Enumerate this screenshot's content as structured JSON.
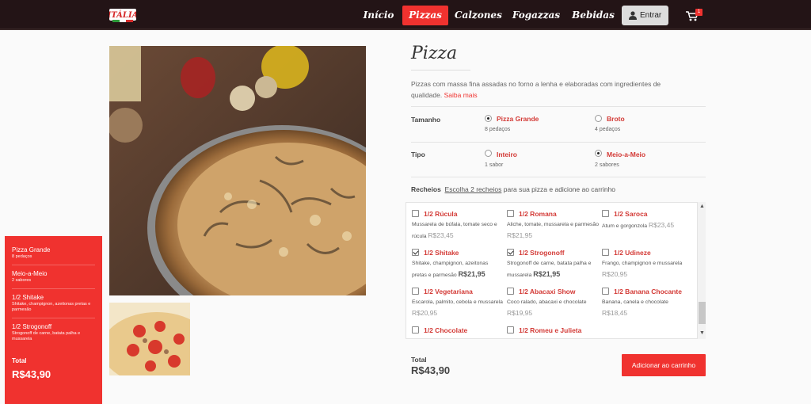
{
  "nav": {
    "logo": "ITÁLIA",
    "items": [
      "Início",
      "Pizzas",
      "Calzones",
      "Fogazzas",
      "Bebidas"
    ],
    "login": "Entrar",
    "cart_count": "1"
  },
  "sidebar": {
    "items": [
      {
        "name": "Pizza Grande",
        "detail": "8 pedaços"
      },
      {
        "name": "Meio-a-Meio",
        "detail": "2 sabores"
      },
      {
        "name": "1/2 Shitake",
        "detail": "Shitake, champignon, azeitonas pretas e parmesão"
      },
      {
        "name": "1/2 Strogonoff",
        "detail": "Strogonoff de carne, batata palha e mussarela"
      }
    ],
    "total_label": "Total",
    "total_value": "R$43,90"
  },
  "product": {
    "title": "Pizza",
    "desc": "Pizzas com massa fina assadas no forno a lenha e elaboradas com ingredientes de qualidade.",
    "more": "Saiba mais"
  },
  "size": {
    "label": "Tamanho",
    "options": [
      {
        "name": "Pizza Grande",
        "sub": "8 pedaços",
        "selected": true
      },
      {
        "name": "Broto",
        "sub": "4 pedaços",
        "selected": false
      }
    ]
  },
  "type": {
    "label": "Tipo",
    "options": [
      {
        "name": "Inteiro",
        "sub": "1 sabor",
        "selected": false
      },
      {
        "name": "Meio-a-Meio",
        "sub": "2 sabores",
        "selected": true
      }
    ]
  },
  "fillings": {
    "label": "Recheios",
    "link": "Escolha 2 recheios",
    "hint": "para sua pizza e adicione ao carrinho",
    "items": [
      {
        "name": "1/2 Rúcula",
        "desc": "Mussarela de búfala, tomate seco e rúcula",
        "price": "R$23,45",
        "checked": false
      },
      {
        "name": "1/2 Romana",
        "desc": "Aliche, tomate, mussarela e parmesão",
        "price": "R$21,95",
        "checked": false
      },
      {
        "name": "1/2 Saroca",
        "desc": "Atum e gorgonzola",
        "price": "R$23,45",
        "checked": false
      },
      {
        "name": "1/2 Shitake",
        "desc": "Shitake, champignon, azeitonas pretas e parmesão",
        "price": "R$21,95",
        "checked": true
      },
      {
        "name": "1/2 Strogonoff",
        "desc": "Strogonoff de carne, batata palha e mussarela",
        "price": "R$21,95",
        "checked": true
      },
      {
        "name": "1/2 Udineze",
        "desc": "Frango, champignon e mussarela",
        "price": "R$20,95",
        "checked": false
      },
      {
        "name": "1/2 Vegetariana",
        "desc": "Escarola, palmito, cebola e mussarela",
        "price": "R$20,95",
        "checked": false
      },
      {
        "name": "1/2 Abacaxi Show",
        "desc": "Coco ralado, abacaxi e chocolate",
        "price": "R$19,95",
        "checked": false
      },
      {
        "name": "1/2 Banana Chocante",
        "desc": "Banana, canela e chocolate",
        "price": "R$18,45",
        "checked": false
      },
      {
        "name": "1/2 Chocolate",
        "desc": "",
        "price": "",
        "checked": false
      },
      {
        "name": "1/2 Romeu e Julieta",
        "desc": "",
        "price": "",
        "checked": false
      }
    ]
  },
  "footer": {
    "total_label": "Total",
    "total_value": "R$43,90",
    "add_button": "Adicionar ao carrinho"
  }
}
